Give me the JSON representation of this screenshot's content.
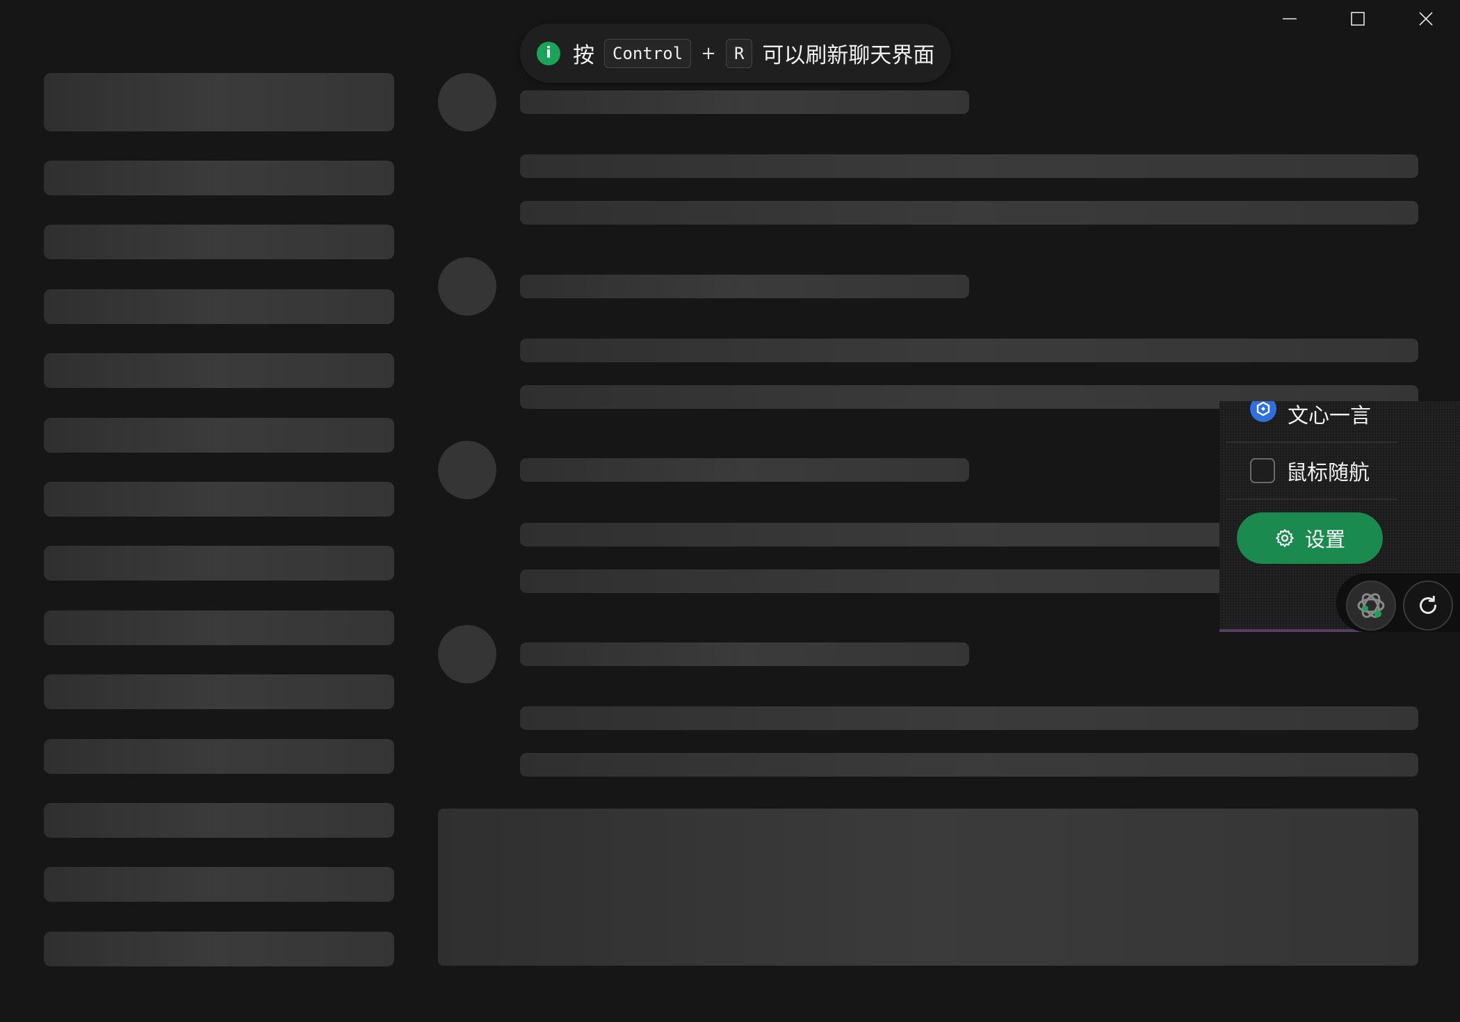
{
  "toast": {
    "press": "按",
    "key1": "Control",
    "plus": "+",
    "key2": "R",
    "message": "可以刷新聊天界面"
  },
  "float_menu": {
    "model_label": "文心一言",
    "mouse_follow_label": "鼠标随航",
    "mouse_follow_checked": false,
    "settings_label": "设置"
  },
  "colors": {
    "background": "#161616",
    "accent_green": "#1a8a4e",
    "info_green": "#1aa45a"
  }
}
